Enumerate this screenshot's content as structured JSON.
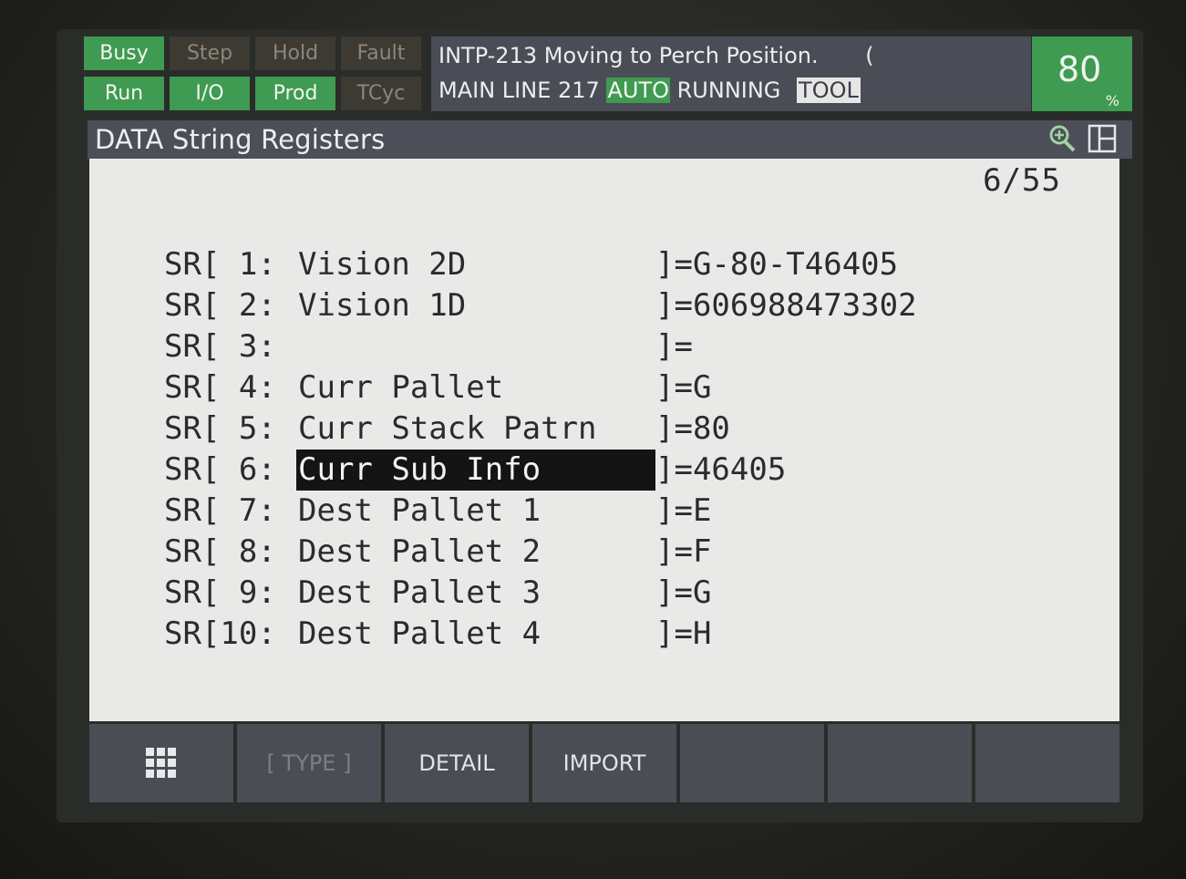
{
  "status": {
    "lamps": [
      {
        "label": "Busy",
        "on": true
      },
      {
        "label": "Step",
        "on": false
      },
      {
        "label": "Hold",
        "on": false
      },
      {
        "label": "Fault",
        "on": false
      },
      {
        "label": "Run",
        "on": true
      },
      {
        "label": "I/O",
        "on": true
      },
      {
        "label": "Prod",
        "on": true
      },
      {
        "label": "TCyc",
        "on": false
      }
    ],
    "message_line1": "INTP-213 Moving to Perch Position.",
    "message_line1_suffix": "(",
    "program_line": "MAIN LINE 217",
    "mode": "AUTO",
    "state": "RUNNING",
    "coord": "TOOL",
    "override_value": "80",
    "override_unit": "%"
  },
  "title": {
    "text": "DATA String Registers",
    "zoom_icon": "zoom-in-icon",
    "split_icon": "split-screen-icon"
  },
  "page_indicator": "6/55",
  "registers": [
    {
      "prefix": "SR[ 1:",
      "comment": "Vision 2D",
      "value": "]=G-80-T46405"
    },
    {
      "prefix": "SR[ 2:",
      "comment": "Vision 1D",
      "value": "]=606988473302"
    },
    {
      "prefix": "SR[ 3:",
      "comment": "",
      "value": "]="
    },
    {
      "prefix": "SR[ 4:",
      "comment": "Curr Pallet",
      "value": "]=G"
    },
    {
      "prefix": "SR[ 5:",
      "comment": "Curr Stack Patrn",
      "value": "]=80"
    },
    {
      "prefix": "SR[ 6:",
      "comment": "Curr Sub Info",
      "value": "]=46405",
      "selected": true
    },
    {
      "prefix": "SR[ 7:",
      "comment": "Dest Pallet 1",
      "value": "]=E"
    },
    {
      "prefix": "SR[ 8:",
      "comment": "Dest Pallet 2",
      "value": "]=F"
    },
    {
      "prefix": "SR[ 9:",
      "comment": "Dest Pallet 3",
      "value": "]=G"
    },
    {
      "prefix": "SR[10:",
      "comment": "Dest Pallet 4",
      "value": "]=H"
    }
  ],
  "function_keys": [
    {
      "label": "",
      "icon": "menu-grid-icon"
    },
    {
      "label": "[ TYPE ]",
      "dim": true
    },
    {
      "label": "DETAIL"
    },
    {
      "label": "IMPORT"
    },
    {
      "label": ""
    },
    {
      "label": ""
    },
    {
      "label": ""
    }
  ],
  "colors": {
    "lamp_on": "#3f9a52",
    "lamp_off": "#3c3a33",
    "message_bg": "#4a4d55",
    "content_bg": "#e9eae7",
    "selection_bg": "#141414"
  }
}
